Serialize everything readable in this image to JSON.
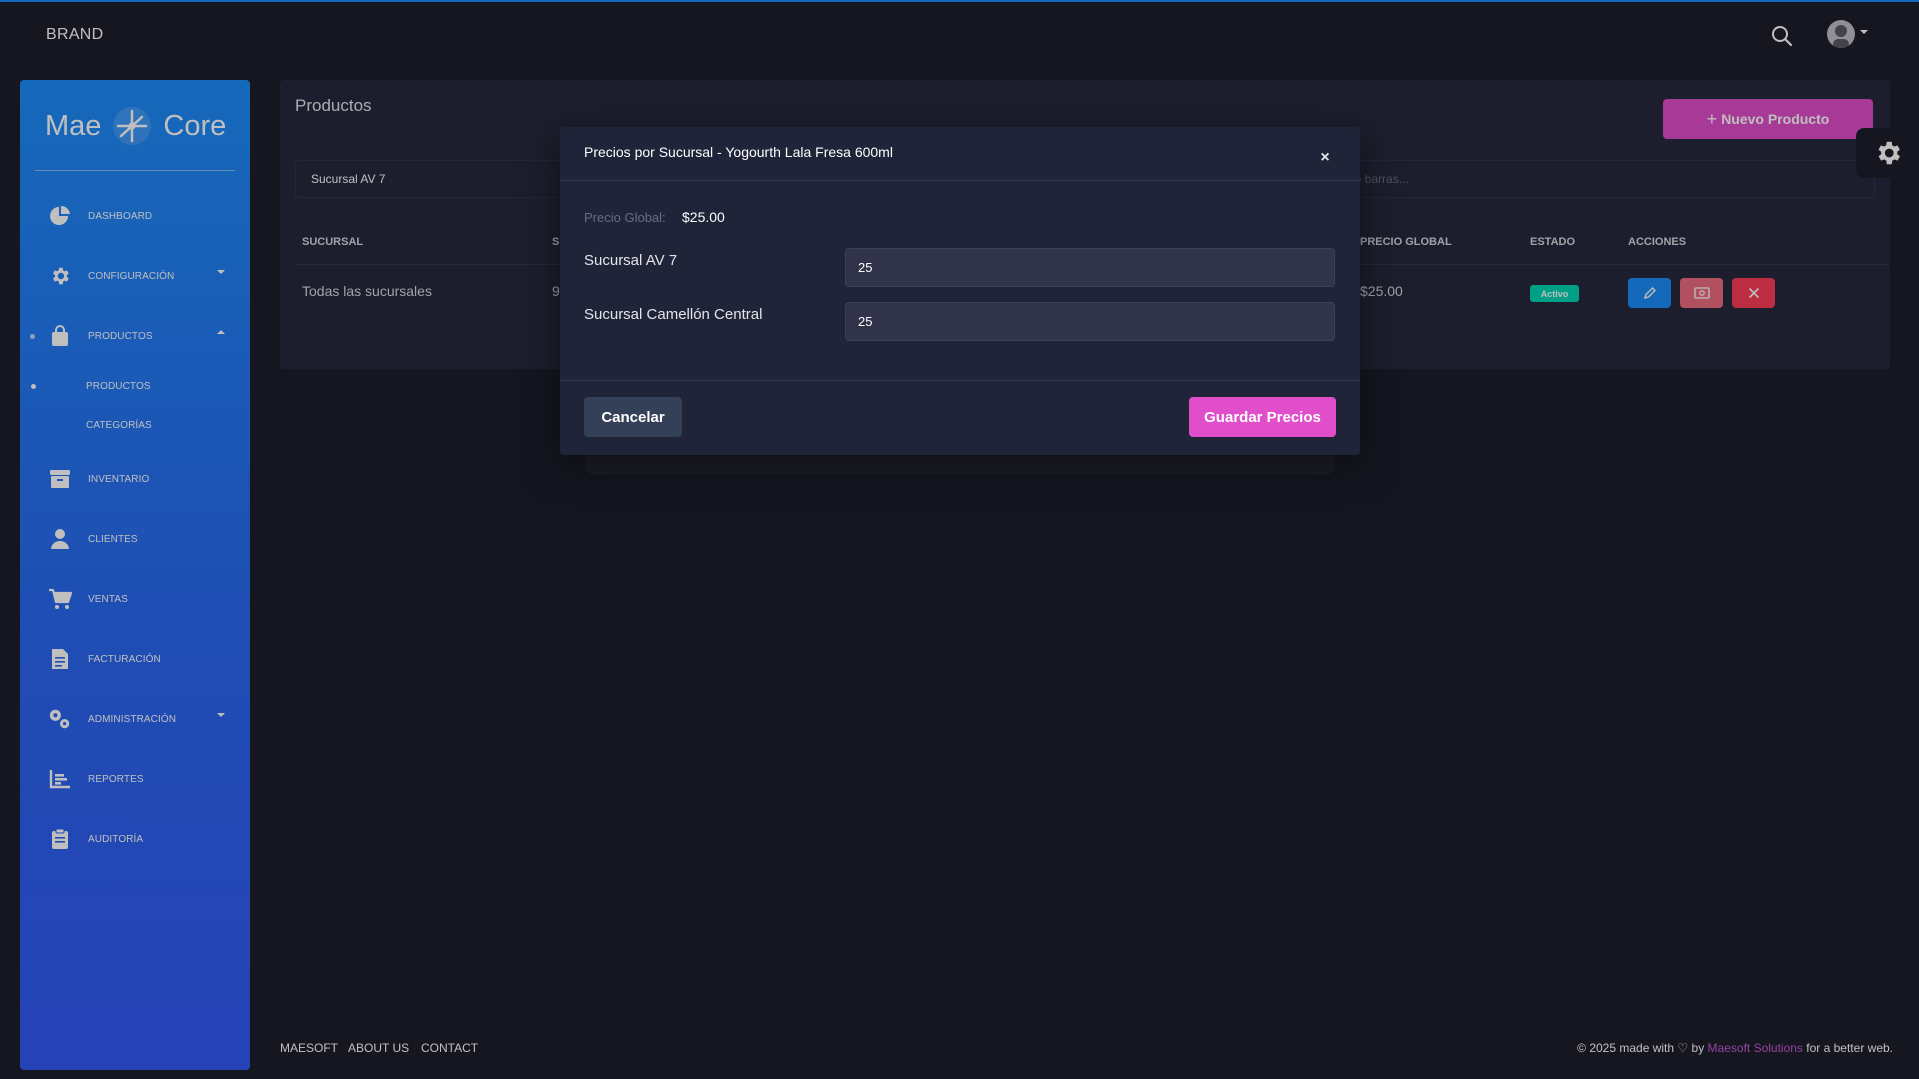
{
  "topbar": {
    "brand": "BRAND",
    "search_icon": "search-icon",
    "avatar_icon": "avatar"
  },
  "colors": {
    "accent_pink": "#e14eca",
    "accent_blue": "#1d8cf8",
    "success": "#00d6b4",
    "danger": "#fd3d57",
    "background": "#1e1e2d",
    "card": "#27293d"
  },
  "sidebar": {
    "logo_left": "Mae",
    "logo_right": "Core",
    "items": [
      {
        "label": "Dashboard",
        "icon": "pie-chart-icon"
      },
      {
        "label": "Configuración",
        "icon": "gear-icon",
        "caret": "down"
      },
      {
        "label": "Productos",
        "icon": "shopping-bag-icon",
        "caret": "up",
        "active": true
      },
      {
        "label": "Inventario",
        "icon": "archive-icon"
      },
      {
        "label": "Clientes",
        "icon": "user-icon"
      },
      {
        "label": "Ventas",
        "icon": "cart-icon"
      },
      {
        "label": "Facturación",
        "icon": "invoice-icon"
      },
      {
        "label": "Administración",
        "icon": "gears-icon",
        "caret": "down"
      },
      {
        "label": "Reportes",
        "icon": "bar-chart-icon"
      },
      {
        "label": "Auditoría",
        "icon": "clipboard-icon"
      }
    ],
    "subitems": [
      {
        "label": "Productos",
        "active": true
      },
      {
        "label": "Categorías"
      }
    ]
  },
  "main": {
    "title": "Productos",
    "new_button": "Nuevo Producto",
    "branch_filter": "Sucursal AV 7",
    "search_placeholder_visible": "de barras...",
    "table": {
      "headers": {
        "branch": "SUCURSAL",
        "col2_partial": "S",
        "global_price": "PRECIO GLOBAL",
        "status": "ESTADO",
        "actions": "ACCIONES"
      },
      "rows": [
        {
          "branch": "Todas las sucursales",
          "col2_partial": "9",
          "global_price": "$25.00",
          "status": "Activo"
        }
      ]
    }
  },
  "modal": {
    "title": "Precios por Sucursal - Yogourth Lala Fresa 600ml",
    "close_icon": "close-icon",
    "global_label": "Precio Global:",
    "global_value": "$25.00",
    "branches": [
      {
        "name": "Sucursal AV 7",
        "price": "25"
      },
      {
        "name": "Sucursal Camellón Central",
        "price": "25"
      }
    ],
    "cancel": "Cancelar",
    "save": "Guardar Precios"
  },
  "footer": {
    "links": [
      "MAESOFT",
      "ABOUT US",
      "CONTACT"
    ],
    "copyright_prefix": "© 2025 made with",
    "heart_icon": "heart-icon",
    "by": "by",
    "company": "Maesoft Solutions",
    "suffix": "for a better web."
  }
}
